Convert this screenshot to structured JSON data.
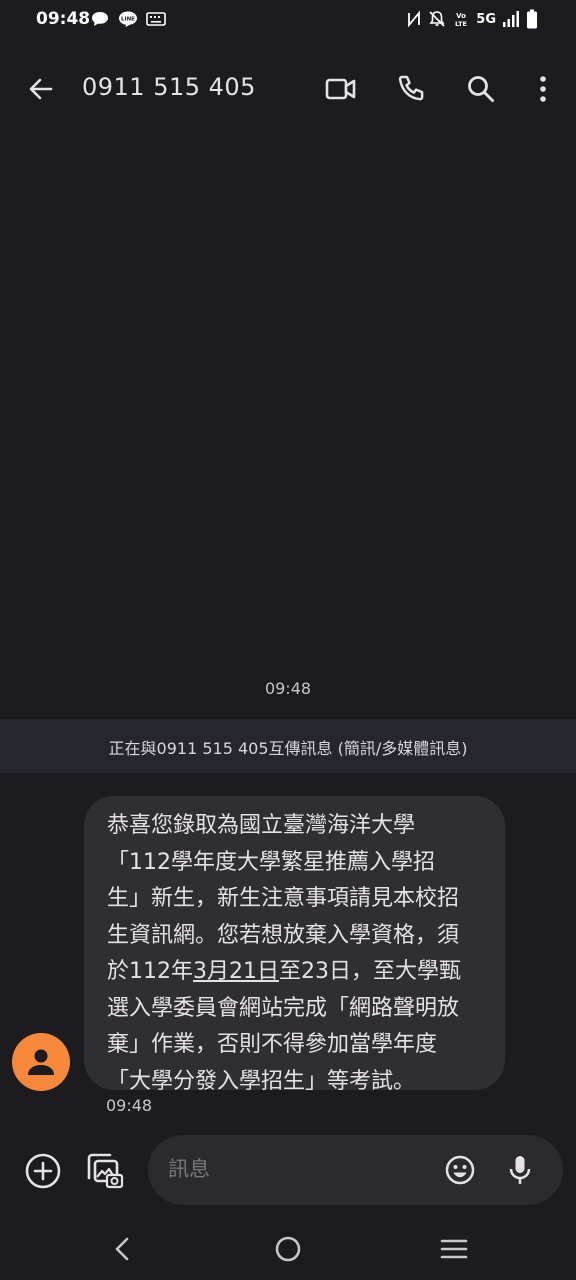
{
  "status_bar": {
    "time": "09:48",
    "network": "5G",
    "left_icons": [
      "chat-bubble-icon",
      "line-app-icon",
      "keyboard-icon"
    ],
    "right_icons": [
      "nfc-icon",
      "bell-off-icon",
      "volte-icon",
      "signal-icon",
      "battery-icon"
    ]
  },
  "app_bar": {
    "title": "0911 515 405",
    "actions": [
      "video-call-icon",
      "phone-icon",
      "search-icon",
      "more-vert-icon"
    ]
  },
  "conversation": {
    "timestamp": "09:48",
    "info_banner": "正在與0911 515 405互傳訊息 (簡訊/多媒體訊息)",
    "message": {
      "lines": [
        "恭喜您錄取為國立臺灣海洋大學",
        "「112學年度大學繁星推薦入學招",
        "生」新生，新生注意事項請見本校招",
        "生資訊網。您若想放棄入學資格，須",
        "於112年",
        "3月21日",
        "至23日，至大學甄",
        "選入學委員會網站完成「網路聲明放",
        "棄」作業，否則不得參加當學年度",
        "「大學分發入學招生」等考試。"
      ],
      "time": "09:48"
    }
  },
  "compose": {
    "placeholder": "訊息"
  },
  "colors": {
    "background": "#1c1b1f",
    "avatar": "#f5883a",
    "bubble": "#2f2f33",
    "banner": "#26262e"
  }
}
